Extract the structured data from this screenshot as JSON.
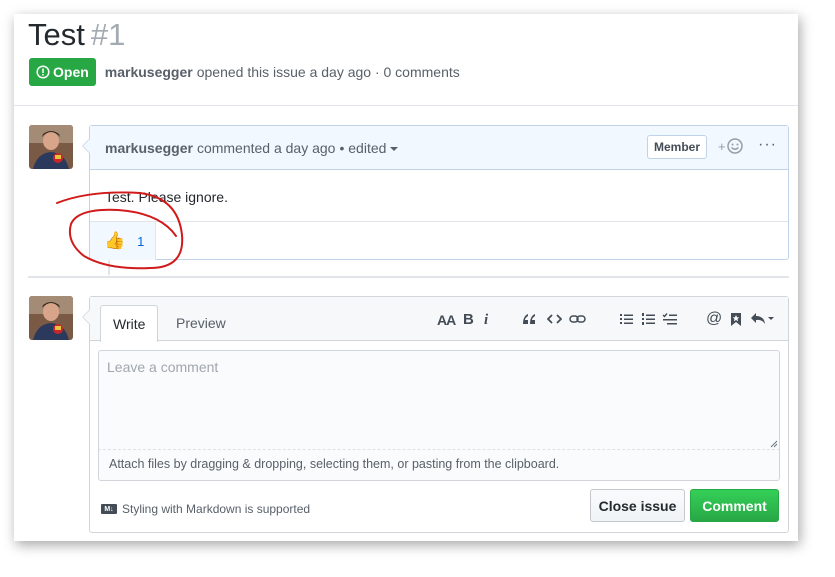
{
  "issue": {
    "title": "Test",
    "number": "#1",
    "state": "Open",
    "author": "markusegger",
    "meta_text": "opened this issue a day ago · 0 comments"
  },
  "comment": {
    "author": "markusegger",
    "meta_text": "commented a day ago",
    "edited_label": "• edited",
    "role_badge": "Member",
    "add_reaction_label": "+",
    "more_label": "···",
    "body": "Test. Please ignore.",
    "reaction": {
      "emoji": "👍",
      "count": "1"
    }
  },
  "new_comment": {
    "tabs": [
      "Write",
      "Preview"
    ],
    "toolbar": {
      "header": "AA",
      "bold": "B",
      "italic": "i",
      "mention": "@"
    },
    "placeholder": "Leave a comment",
    "attach_text": "Attach files by dragging & dropping, selecting them, or pasting from the clipboard.",
    "markdown_note": "Styling with Markdown is supported",
    "markdown_icon_label": "M↓",
    "close_button": "Close issue",
    "comment_button": "Comment"
  },
  "colors": {
    "open_green": "#28a745",
    "comment_header_bg": "#f1f8ff",
    "annotation_red": "#d11a1a"
  }
}
